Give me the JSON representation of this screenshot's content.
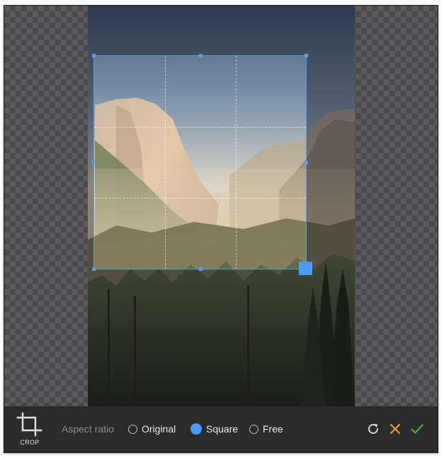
{
  "toolbar": {
    "crop_tool": {
      "label": "CROP",
      "icon": "crop-icon"
    },
    "aspect_ratio_label": "Aspect ratio",
    "options": [
      {
        "label": "Original",
        "selected": false
      },
      {
        "label": "Square",
        "selected": true
      },
      {
        "label": "Free",
        "selected": false
      }
    ],
    "actions": [
      {
        "name": "reset",
        "icon": "rotate-reset-icon",
        "color": "#d8d8d8"
      },
      {
        "name": "cancel",
        "icon": "close-icon",
        "color": "#e8a02b"
      },
      {
        "name": "apply",
        "icon": "checkmark-icon",
        "color": "#4caf50"
      }
    ]
  },
  "colors": {
    "accent": "#4a9bff",
    "toolbar_bg": "#2b2b2b",
    "crop_border": "#5b9bf0"
  }
}
